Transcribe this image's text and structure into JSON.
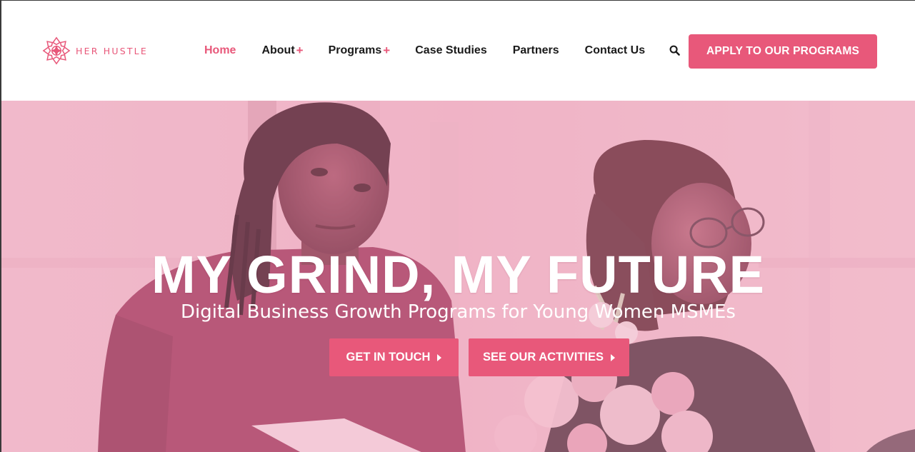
{
  "brand": {
    "name": "HER HUSTLE",
    "logo_icon": "flower-mandala-icon",
    "accent_color": "#e8587a"
  },
  "nav": {
    "items": [
      {
        "label": "Home",
        "active": true,
        "has_submenu": false
      },
      {
        "label": "About",
        "active": false,
        "has_submenu": true
      },
      {
        "label": "Programs",
        "active": false,
        "has_submenu": true
      },
      {
        "label": "Case Studies",
        "active": false,
        "has_submenu": false
      },
      {
        "label": "Partners",
        "active": false,
        "has_submenu": false
      },
      {
        "label": "Contact Us",
        "active": false,
        "has_submenu": false
      }
    ],
    "submenu_indicator": "+",
    "search_icon": "search-icon"
  },
  "cta": {
    "apply_label": "APPLY TO OUR PROGRAMS"
  },
  "hero": {
    "title": "MY GRIND, MY FUTURE",
    "subtitle": "Digital Business Growth Programs for Young Women MSMEs",
    "buttons": [
      {
        "label": "GET IN TOUCH",
        "icon": "caret-right-icon"
      },
      {
        "label": "SEE OUR ACTIVITIES",
        "icon": "caret-right-icon"
      }
    ]
  }
}
